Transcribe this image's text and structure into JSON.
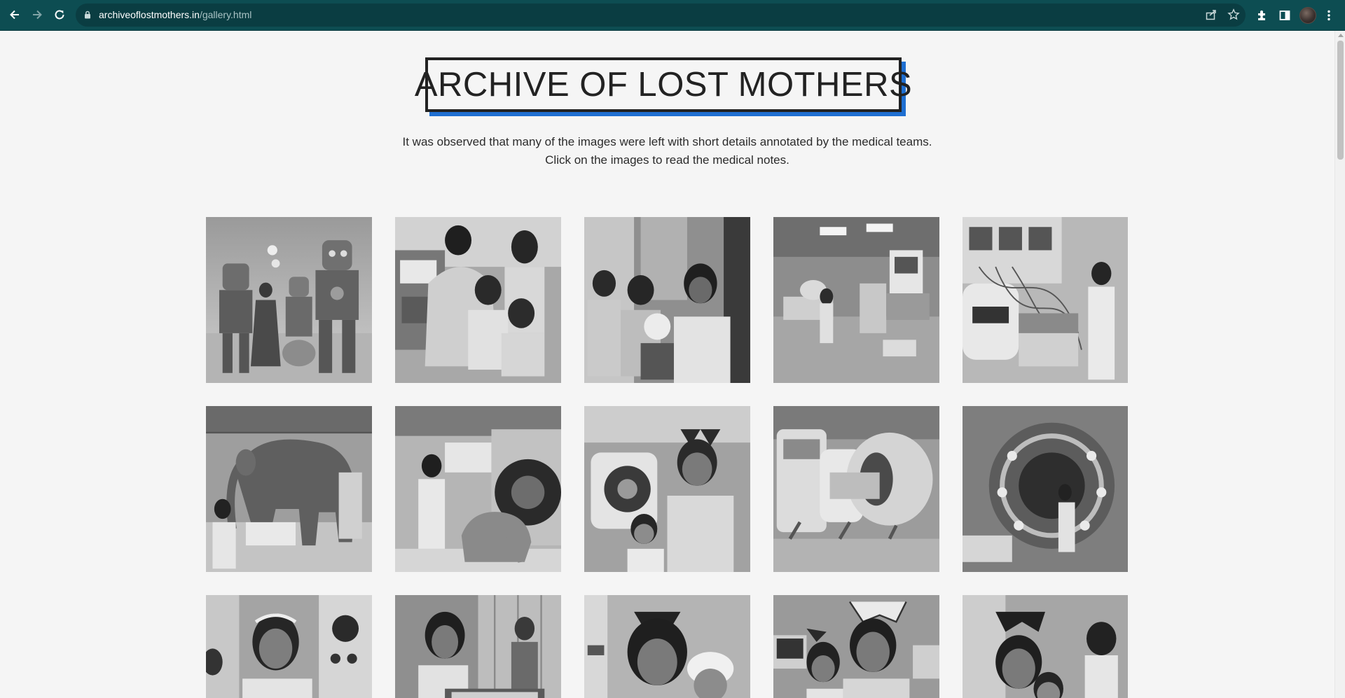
{
  "browser": {
    "url_host": "archiveoflostmothers.in",
    "url_path": "/gallery.html",
    "icons": {
      "back": "arrow-left-icon",
      "forward": "arrow-right-icon",
      "reload": "reload-icon",
      "lock": "lock-icon",
      "share": "share-icon",
      "bookmark": "star-icon",
      "extensions": "puzzle-icon",
      "sidepanel": "side-panel-icon",
      "profile": "avatar",
      "menu": "kebab-menu-icon"
    }
  },
  "page": {
    "title": "ARCHIVE OF LOST MOTHERS",
    "subtitle_line1": "It was observed that many of the images were left with short details annotated by the medical teams.",
    "subtitle_line2": "Click on the images to read the medical notes.",
    "accent_color": "#1f6fd1",
    "text_color": "#222222",
    "background": "#f5f5f5"
  },
  "gallery": {
    "rows": 3,
    "columns": 5,
    "images": [
      {
        "name": "gallery-image-1",
        "scene": "robots-and-woman"
      },
      {
        "name": "gallery-image-2",
        "scene": "woman-at-machine-with-girls"
      },
      {
        "name": "gallery-image-3",
        "scene": "mother-and-children"
      },
      {
        "name": "gallery-image-4",
        "scene": "hospital-room-equipment"
      },
      {
        "name": "gallery-image-5",
        "scene": "woman-with-wired-machines"
      },
      {
        "name": "gallery-image-6",
        "scene": "elephant-in-lab"
      },
      {
        "name": "gallery-image-7",
        "scene": "girl-with-scanner-and-elephant"
      },
      {
        "name": "gallery-image-8",
        "scene": "girl-with-cat-ears-and-machine"
      },
      {
        "name": "gallery-image-9",
        "scene": "mri-machines"
      },
      {
        "name": "gallery-image-10",
        "scene": "woman-in-circular-machine"
      },
      {
        "name": "gallery-image-11",
        "scene": "girl-with-headband-and-panel"
      },
      {
        "name": "gallery-image-12",
        "scene": "girl-at-table-with-man"
      },
      {
        "name": "gallery-image-13",
        "scene": "girls-with-cat-ears"
      },
      {
        "name": "gallery-image-14",
        "scene": "girls-with-cat-ears-and-monitors"
      },
      {
        "name": "gallery-image-15",
        "scene": "girls-with-cat-ears-closeup"
      }
    ]
  }
}
